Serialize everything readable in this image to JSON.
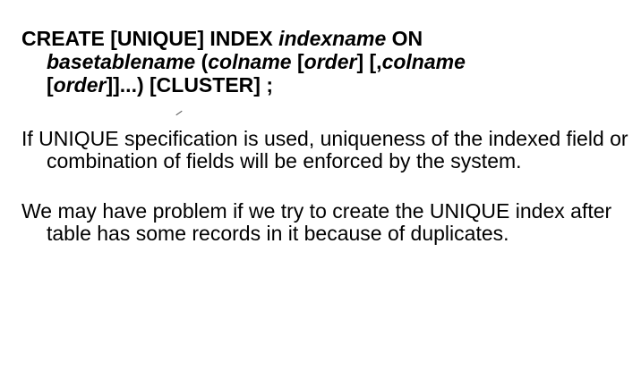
{
  "syntax": {
    "kw_create": "CREATE [UNIQUE] INDEX ",
    "indexname": "indexname",
    "kw_on": " ON",
    "basetablename": "basetablename",
    "open": " (",
    "colname1": "colname",
    "space1": " [",
    "order1": "order",
    "bracket_mid": "] [,",
    "colname2": "colname",
    "bracket_open2": "[",
    "order2": "order",
    "tail": "]]...) [CLUSTER] ;"
  },
  "paragraphs": [
    "If UNIQUE specification is used, uniqueness of the indexed field or combination of fields will be enforced by the system.",
    "We may have problem if we try to create the UNIQUE index after table has some records in it because of duplicates."
  ]
}
